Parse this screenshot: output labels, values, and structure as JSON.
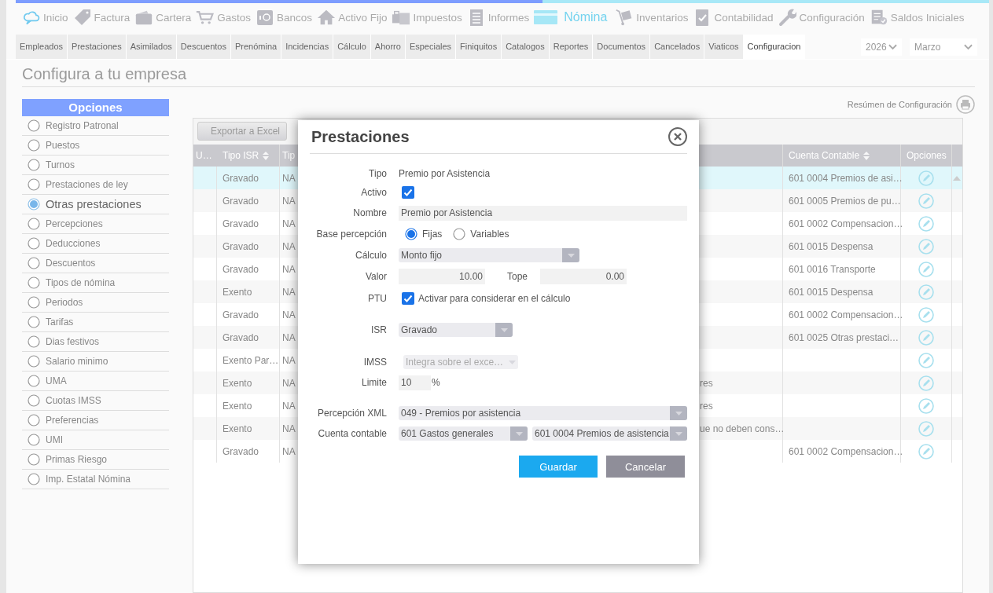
{
  "top_nav": [
    {
      "label": "Inicio",
      "selected": false
    },
    {
      "label": "Factura",
      "selected": false
    },
    {
      "label": "Cartera",
      "selected": false
    },
    {
      "label": "Gastos",
      "selected": false
    },
    {
      "label": "Bancos",
      "selected": false
    },
    {
      "label": "Activo Fijo",
      "selected": false
    },
    {
      "label": "Impuestos",
      "selected": false
    },
    {
      "label": "Informes",
      "selected": false
    },
    {
      "label": "Nómina",
      "selected": true
    },
    {
      "label": "Inventarios",
      "selected": false
    },
    {
      "label": "Contabilidad",
      "selected": false
    },
    {
      "label": "Configuración",
      "selected": false
    },
    {
      "label": "Saldos Iniciales",
      "selected": false
    }
  ],
  "sub_nav": [
    {
      "label": "Empleados",
      "selected": false
    },
    {
      "label": "Prestaciones",
      "selected": false
    },
    {
      "label": "Asimilados",
      "selected": false
    },
    {
      "label": "Descuentos",
      "selected": false
    },
    {
      "label": "Prenómina",
      "selected": false
    },
    {
      "label": "Incidencias",
      "selected": false
    },
    {
      "label": "Cálculo",
      "selected": false
    },
    {
      "label": "Ahorro",
      "selected": false
    },
    {
      "label": "Especiales",
      "selected": false
    },
    {
      "label": "Finiquitos",
      "selected": false
    },
    {
      "label": "Catalogos",
      "selected": false
    },
    {
      "label": "Reportes",
      "selected": false
    },
    {
      "label": "Documentos",
      "selected": false
    },
    {
      "label": "Cancelados",
      "selected": false
    },
    {
      "label": "Viaticos",
      "selected": false
    },
    {
      "label": "Configuracion",
      "selected": true
    }
  ],
  "period": {
    "year": "2026",
    "month": "Marzo"
  },
  "page_title": "Configura a tu empresa",
  "sidebar": {
    "title": "Opciones",
    "items": [
      {
        "label": "Registro Patronal",
        "selected": false
      },
      {
        "label": "Puestos",
        "selected": false
      },
      {
        "label": "Turnos",
        "selected": false
      },
      {
        "label": "Prestaciones de ley",
        "selected": false
      },
      {
        "label": "Otras prestaciones",
        "selected": true
      },
      {
        "label": "Percepciones",
        "selected": false
      },
      {
        "label": "Deducciones",
        "selected": false
      },
      {
        "label": "Descuentos",
        "selected": false
      },
      {
        "label": "Tipos de nómina",
        "selected": false
      },
      {
        "label": "Periodos",
        "selected": false
      },
      {
        "label": "Tarifas",
        "selected": false
      },
      {
        "label": "Dias festivos",
        "selected": false
      },
      {
        "label": "Salario minimo",
        "selected": false
      },
      {
        "label": "UMA",
        "selected": false
      },
      {
        "label": "Cuotas IMSS",
        "selected": false
      },
      {
        "label": "Preferencias",
        "selected": false
      },
      {
        "label": "UMI",
        "selected": false
      },
      {
        "label": "Primas Riesgo",
        "selected": false
      },
      {
        "label": "Imp. Estatal Nómina",
        "selected": false
      }
    ]
  },
  "summary_link": "Resúmen de Configuración",
  "table": {
    "export_button": "Exportar a Excel",
    "columns": [
      {
        "label": "U…"
      },
      {
        "label": "Tipo ISR",
        "sortable": true
      },
      {
        "label": "Tip"
      },
      {
        "label": "Cuenta Contable",
        "sortable": true
      },
      {
        "label": "Opciones"
      }
    ],
    "rows": [
      {
        "selected": true,
        "tipo_isr": "Gravado",
        "column_3": "NA",
        "cuenta_contable": "601 0004 Premios de asi…"
      },
      {
        "selected": false,
        "tipo_isr": "Gravado",
        "column_3": "NA",
        "cuenta_contable": "601 0005 Premios de pu…"
      },
      {
        "selected": false,
        "tipo_isr": "Gravado",
        "column_3": "NA",
        "cuenta_contable": "601 0002 Compensacion…"
      },
      {
        "selected": false,
        "tipo_isr": "Gravado",
        "column_3": "NA",
        "cuenta_contable": "601 0015 Despensa"
      },
      {
        "selected": false,
        "tipo_isr": "Gravado",
        "column_3": "NA",
        "cuenta_contable": "601 0016 Transporte"
      },
      {
        "selected": false,
        "tipo_isr": "Exento",
        "column_3": "NA",
        "cuenta_contable": "601 0015 Despensa"
      },
      {
        "selected": false,
        "tipo_isr": "Gravado",
        "column_3": "NA",
        "cuenta_contable": "601 0002 Compensacion…"
      },
      {
        "selected": false,
        "tipo_isr": "Gravado",
        "column_3": "NA",
        "cuenta_contable": "601 0025 Otras prestaci…"
      },
      {
        "selected": false,
        "tipo_isr": "Exento Par…",
        "column_3": "NA"
      },
      {
        "selected": false,
        "tipo_isr": "Exento",
        "column_3": "NA",
        "column_4": "res"
      },
      {
        "selected": false,
        "tipo_isr": "Exento",
        "column_3": "NA",
        "column_4": "res"
      },
      {
        "selected": false,
        "tipo_isr": "Exento",
        "column_3": "NA",
        "column_4": "ue no deben cons…"
      },
      {
        "selected": false,
        "tipo_isr": "Gravado",
        "column_3": "NA",
        "cuenta_contable": "601 0002 Compensacion…"
      }
    ]
  },
  "dialog": {
    "title": "Prestaciones",
    "tipo": {
      "label": "Tipo",
      "value": "Premio por Asistencia"
    },
    "activo": {
      "label": "Activo",
      "checked": true
    },
    "nombre": {
      "label": "Nombre",
      "value": "Premio por Asistencia"
    },
    "base_percepcion": {
      "label": "Base percepción",
      "options": [
        {
          "label": "Fijas",
          "selected": true
        },
        {
          "label": "Variables",
          "selected": false
        }
      ]
    },
    "calculo": {
      "label": "Cálculo",
      "value": "Monto fijo"
    },
    "valor": {
      "label": "Valor",
      "value": "10.00"
    },
    "tope": {
      "label": "Tope",
      "value": "0.00"
    },
    "ptu": {
      "label": "PTU",
      "checked": true,
      "text": "Activar para considerar en el cálculo"
    },
    "isr": {
      "label": "ISR",
      "value": "Gravado"
    },
    "imss": {
      "label": "IMSS",
      "value": "Integra sobre el exce…",
      "disabled": true
    },
    "limite": {
      "label": "Limite",
      "value": "10",
      "unit": "%"
    },
    "percepcion_xml": {
      "label": "Percepción XML",
      "value": "049 - Premios por asistencia"
    },
    "cuenta_contable": {
      "label": "Cuenta contable",
      "values": [
        "601 Gastos generales",
        "601 0004 Premios de asistencia"
      ]
    },
    "buttons": [
      {
        "label": "Guardar",
        "kind": "primary"
      },
      {
        "label": "Cancelar",
        "kind": "secondary"
      }
    ]
  }
}
